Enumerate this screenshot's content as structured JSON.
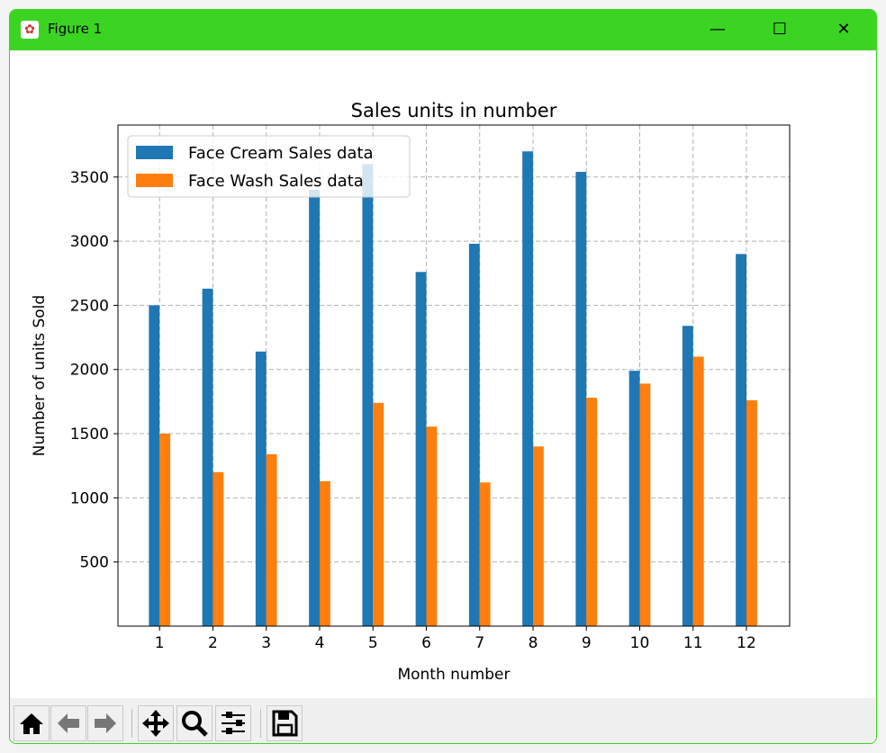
{
  "window": {
    "title": "Figure 1",
    "minimize": "—",
    "maximize": "☐",
    "close": "✕",
    "accent": "#3bd422"
  },
  "toolbar": {
    "buttons": [
      "home-icon",
      "back-icon",
      "forward-icon",
      "pan-icon",
      "zoom-icon",
      "configure-subplots-icon",
      "save-icon"
    ]
  },
  "chart_data": {
    "type": "bar",
    "title": "Sales units in number",
    "xlabel": "Month number",
    "ylabel": "Number of units Sold",
    "categories": [
      1,
      2,
      3,
      4,
      5,
      6,
      7,
      8,
      9,
      10,
      11,
      12
    ],
    "series": [
      {
        "name": "Face Cream Sales data",
        "color": "#1f77b4",
        "values": [
          2500,
          2630,
          2140,
          3400,
          3600,
          2760,
          2980,
          3700,
          3540,
          1990,
          2340,
          2900
        ]
      },
      {
        "name": "Face Wash Sales data",
        "color": "#ff7f0e",
        "values": [
          1500,
          1200,
          1340,
          1130,
          1740,
          1555,
          1120,
          1400,
          1780,
          1890,
          2100,
          1760
        ]
      }
    ],
    "xticks": [
      "1",
      "2",
      "3",
      "4",
      "5",
      "6",
      "7",
      "8",
      "9",
      "10",
      "11",
      "12"
    ],
    "yticks": [
      "500",
      "1000",
      "1500",
      "2000",
      "2500",
      "3000",
      "3500"
    ],
    "ylim": [
      0,
      3905
    ],
    "xlim": [
      0.22,
      12.81
    ],
    "grid": true,
    "grid_style": "dashed",
    "legend_position": "upper-left"
  }
}
